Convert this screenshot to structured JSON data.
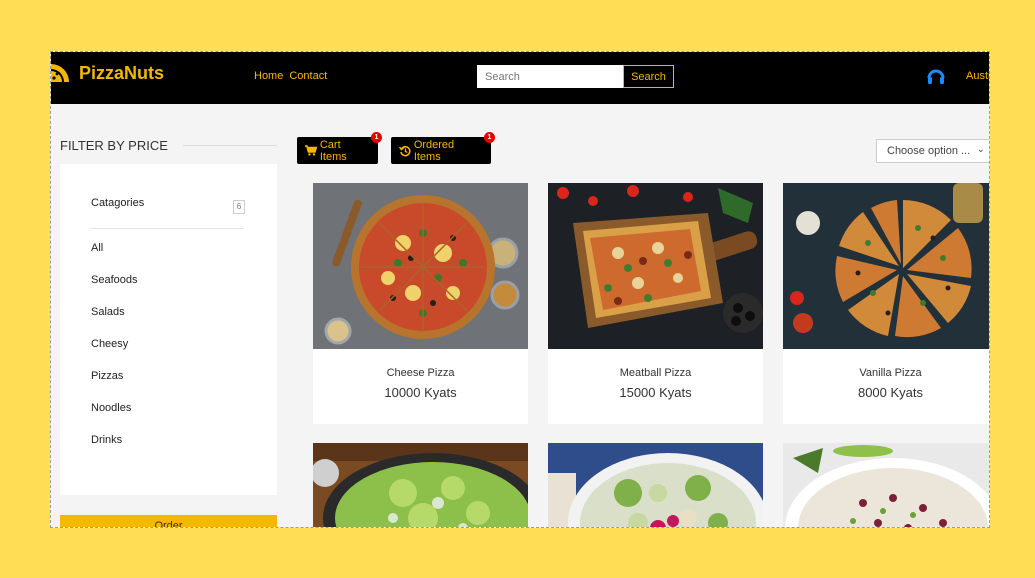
{
  "brand": {
    "name": "PizzaNuts",
    "color": "#f5b800"
  },
  "nav": {
    "links": [
      "Home",
      "Contact"
    ]
  },
  "search": {
    "placeholder": "Search",
    "button": "Search"
  },
  "user": {
    "name": "Austi",
    "icon": "user-headset-icon"
  },
  "filter": {
    "title": "FILTER BY PRICE",
    "categories_label": "Catagories",
    "count": "6",
    "items": [
      "All",
      "Seafoods",
      "Salads",
      "Cheesy",
      "Pizzas",
      "Noodles",
      "Drinks"
    ]
  },
  "toolbar": {
    "cart_label": "Cart Items",
    "cart_count": "1",
    "ordered_label": "Ordered Items",
    "ordered_count": "1",
    "sort_placeholder": "Choose option ..."
  },
  "order_button": "Order",
  "products": [
    {
      "name": "Cheese Pizza",
      "price": "10000 Kyats"
    },
    {
      "name": "Meatball Pizza",
      "price": "15000 Kyats"
    },
    {
      "name": "Vanilla Pizza",
      "price": "8000 Kyats"
    }
  ],
  "colors": {
    "accent": "#f5b800",
    "page_bg": "#ffdd55",
    "nav_bg": "#000000",
    "badge": "#e50000"
  }
}
